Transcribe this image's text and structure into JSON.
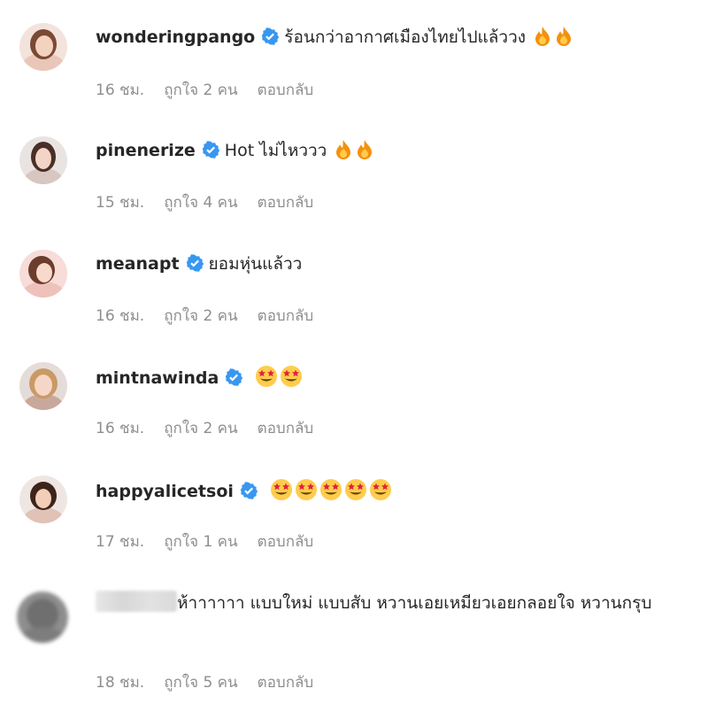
{
  "colors": {
    "verified": "#3897f0",
    "meta_text": "#8e8e8e",
    "text": "#262626"
  },
  "comments": [
    {
      "username": "wonderingpango",
      "text": "ร้อนกว่าอากาศเมืองไทยไปแล้ววง",
      "emoji": "fire",
      "emoji_count": 2,
      "time": "16 ชม.",
      "likes": "ถูกใจ 2 คน",
      "reply": "ตอบกลับ"
    },
    {
      "username": "pinenerize",
      "text": "Hot ไม่ไหววว",
      "emoji": "fire",
      "emoji_count": 2,
      "time": "15 ชม.",
      "likes": "ถูกใจ 4 คน",
      "reply": "ตอบกลับ"
    },
    {
      "username": "meanapt",
      "text": "ยอมหุ่นแล้วว",
      "emoji": "",
      "emoji_count": 0,
      "time": "16 ชม.",
      "likes": "ถูกใจ 2 คน",
      "reply": "ตอบกลับ"
    },
    {
      "username": "mintnawinda",
      "text": "",
      "emoji": "star-struck",
      "emoji_count": 2,
      "time": "16 ชม.",
      "likes": "ถูกใจ 2 คน",
      "reply": "ตอบกลับ"
    },
    {
      "username": "happyalicetsoi",
      "text": "",
      "emoji": "star-struck",
      "emoji_count": 5,
      "time": "17 ชม.",
      "likes": "ถูกใจ 1 คน",
      "reply": "ตอบกลับ"
    },
    {
      "username": "",
      "text": "ห้าาาาาา แบบใหม่ แบบสับ หวานเอยเหมียวเอยกลอยใจ หวานกรุบ",
      "emoji": "",
      "emoji_count": 0,
      "time": "18 ชม.",
      "likes": "ถูกใจ 5 คน",
      "reply": "ตอบกลับ"
    }
  ]
}
